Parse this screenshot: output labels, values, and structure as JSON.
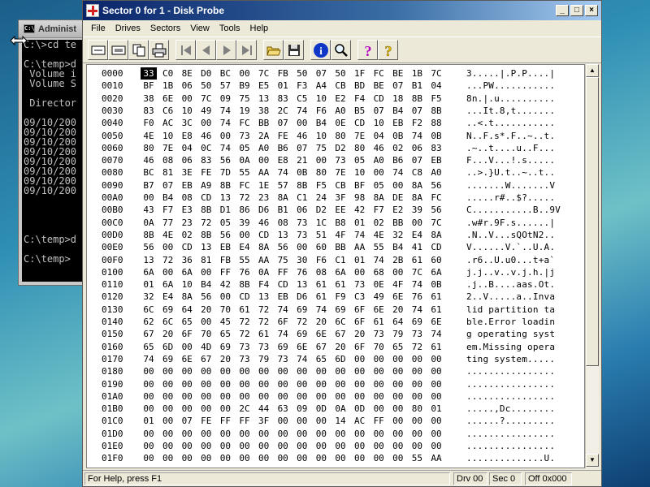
{
  "console": {
    "title": "Administ",
    "lines": [
      "C:\\>cd te",
      "",
      "C:\\temp>d",
      " Volume i",
      " Volume S",
      "",
      " Director",
      "",
      "09/10/200",
      "09/10/200",
      "09/10/200",
      "09/10/200",
      "09/10/200",
      "09/10/200",
      "09/10/200",
      "09/10/200",
      "",
      "",
      "",
      "",
      "C:\\temp>d",
      "",
      "C:\\temp>"
    ]
  },
  "window": {
    "title": "Sector 0 for 1 - Disk Probe"
  },
  "menu": [
    "File",
    "Drives",
    "Sectors",
    "View",
    "Tools",
    "Help"
  ],
  "toolbar": {
    "icons": [
      "read-sector-icon",
      "write-sector-icon",
      "copy-icon",
      "print-icon",
      "first-sector-icon",
      "previous-sector-icon",
      "next-sector-icon",
      "last-sector-icon",
      "open-file-icon",
      "save-icon",
      "info-icon",
      "find-icon",
      "help-icon",
      "context-help-icon"
    ]
  },
  "hex": {
    "selected_byte": "33",
    "rows": [
      {
        "offset": "0000",
        "bytes": [
          "33",
          "C0",
          "8E",
          "D0",
          "BC",
          "00",
          "7C",
          "FB",
          "50",
          "07",
          "50",
          "1F",
          "FC",
          "BE",
          "1B",
          "7C"
        ],
        "ascii": "3.....|.P.P....|"
      },
      {
        "offset": "0010",
        "bytes": [
          "BF",
          "1B",
          "06",
          "50",
          "57",
          "B9",
          "E5",
          "01",
          "F3",
          "A4",
          "CB",
          "BD",
          "BE",
          "07",
          "B1",
          "04"
        ],
        "ascii": "...PW..........."
      },
      {
        "offset": "0020",
        "bytes": [
          "38",
          "6E",
          "00",
          "7C",
          "09",
          "75",
          "13",
          "83",
          "C5",
          "10",
          "E2",
          "F4",
          "CD",
          "18",
          "8B",
          "F5"
        ],
        "ascii": "8n.|.u.........."
      },
      {
        "offset": "0030",
        "bytes": [
          "83",
          "C6",
          "10",
          "49",
          "74",
          "19",
          "38",
          "2C",
          "74",
          "F6",
          "A0",
          "B5",
          "07",
          "B4",
          "07",
          "8B"
        ],
        "ascii": "...It.8,t......."
      },
      {
        "offset": "0040",
        "bytes": [
          "F0",
          "AC",
          "3C",
          "00",
          "74",
          "FC",
          "BB",
          "07",
          "00",
          "B4",
          "0E",
          "CD",
          "10",
          "EB",
          "F2",
          "88"
        ],
        "ascii": "..<.t..........."
      },
      {
        "offset": "0050",
        "bytes": [
          "4E",
          "10",
          "E8",
          "46",
          "00",
          "73",
          "2A",
          "FE",
          "46",
          "10",
          "80",
          "7E",
          "04",
          "0B",
          "74",
          "0B"
        ],
        "ascii": "N..F.s*.F..~..t."
      },
      {
        "offset": "0060",
        "bytes": [
          "80",
          "7E",
          "04",
          "0C",
          "74",
          "05",
          "A0",
          "B6",
          "07",
          "75",
          "D2",
          "80",
          "46",
          "02",
          "06",
          "83"
        ],
        "ascii": ".~..t....u..F..."
      },
      {
        "offset": "0070",
        "bytes": [
          "46",
          "08",
          "06",
          "83",
          "56",
          "0A",
          "00",
          "E8",
          "21",
          "00",
          "73",
          "05",
          "A0",
          "B6",
          "07",
          "EB"
        ],
        "ascii": "F...V...!.s....."
      },
      {
        "offset": "0080",
        "bytes": [
          "BC",
          "81",
          "3E",
          "FE",
          "7D",
          "55",
          "AA",
          "74",
          "0B",
          "80",
          "7E",
          "10",
          "00",
          "74",
          "C8",
          "A0"
        ],
        "ascii": "..>.}U.t..~..t.."
      },
      {
        "offset": "0090",
        "bytes": [
          "B7",
          "07",
          "EB",
          "A9",
          "8B",
          "FC",
          "1E",
          "57",
          "8B",
          "F5",
          "CB",
          "BF",
          "05",
          "00",
          "8A",
          "56"
        ],
        "ascii": ".......W.......V"
      },
      {
        "offset": "00A0",
        "bytes": [
          "00",
          "B4",
          "08",
          "CD",
          "13",
          "72",
          "23",
          "8A",
          "C1",
          "24",
          "3F",
          "98",
          "8A",
          "DE",
          "8A",
          "FC"
        ],
        "ascii": ".....r#..$?....."
      },
      {
        "offset": "00B0",
        "bytes": [
          "43",
          "F7",
          "E3",
          "8B",
          "D1",
          "86",
          "D6",
          "B1",
          "06",
          "D2",
          "EE",
          "42",
          "F7",
          "E2",
          "39",
          "56"
        ],
        "ascii": "C...........B..9V"
      },
      {
        "offset": "00C0",
        "bytes": [
          "0A",
          "77",
          "23",
          "72",
          "05",
          "39",
          "46",
          "08",
          "73",
          "1C",
          "B8",
          "01",
          "02",
          "BB",
          "00",
          "7C"
        ],
        "ascii": ".w#r.9F.s......|"
      },
      {
        "offset": "00D0",
        "bytes": [
          "8B",
          "4E",
          "02",
          "8B",
          "56",
          "00",
          "CD",
          "13",
          "73",
          "51",
          "4F",
          "74",
          "4E",
          "32",
          "E4",
          "8A"
        ],
        "ascii": ".N..V...sQOtN2.."
      },
      {
        "offset": "00E0",
        "bytes": [
          "56",
          "00",
          "CD",
          "13",
          "EB",
          "E4",
          "8A",
          "56",
          "00",
          "60",
          "BB",
          "AA",
          "55",
          "B4",
          "41",
          "CD"
        ],
        "ascii": "V......V.`..U.A."
      },
      {
        "offset": "00F0",
        "bytes": [
          "13",
          "72",
          "36",
          "81",
          "FB",
          "55",
          "AA",
          "75",
          "30",
          "F6",
          "C1",
          "01",
          "74",
          "2B",
          "61",
          "60"
        ],
        "ascii": ".r6..U.u0...t+a`"
      },
      {
        "offset": "0100",
        "bytes": [
          "6A",
          "00",
          "6A",
          "00",
          "FF",
          "76",
          "0A",
          "FF",
          "76",
          "08",
          "6A",
          "00",
          "68",
          "00",
          "7C",
          "6A"
        ],
        "ascii": "j.j..v..v.j.h.|j"
      },
      {
        "offset": "0110",
        "bytes": [
          "01",
          "6A",
          "10",
          "B4",
          "42",
          "8B",
          "F4",
          "CD",
          "13",
          "61",
          "61",
          "73",
          "0E",
          "4F",
          "74",
          "0B"
        ],
        "ascii": ".j..B....aas.Ot."
      },
      {
        "offset": "0120",
        "bytes": [
          "32",
          "E4",
          "8A",
          "56",
          "00",
          "CD",
          "13",
          "EB",
          "D6",
          "61",
          "F9",
          "C3",
          "49",
          "6E",
          "76",
          "61"
        ],
        "ascii": "2..V.....a..Inva"
      },
      {
        "offset": "0130",
        "bytes": [
          "6C",
          "69",
          "64",
          "20",
          "70",
          "61",
          "72",
          "74",
          "69",
          "74",
          "69",
          "6F",
          "6E",
          "20",
          "74",
          "61"
        ],
        "ascii": "lid partition ta"
      },
      {
        "offset": "0140",
        "bytes": [
          "62",
          "6C",
          "65",
          "00",
          "45",
          "72",
          "72",
          "6F",
          "72",
          "20",
          "6C",
          "6F",
          "61",
          "64",
          "69",
          "6E"
        ],
        "ascii": "ble.Error loadin"
      },
      {
        "offset": "0150",
        "bytes": [
          "67",
          "20",
          "6F",
          "70",
          "65",
          "72",
          "61",
          "74",
          "69",
          "6E",
          "67",
          "20",
          "73",
          "79",
          "73",
          "74"
        ],
        "ascii": "g operating syst"
      },
      {
        "offset": "0160",
        "bytes": [
          "65",
          "6D",
          "00",
          "4D",
          "69",
          "73",
          "73",
          "69",
          "6E",
          "67",
          "20",
          "6F",
          "70",
          "65",
          "72",
          "61"
        ],
        "ascii": "em.Missing opera"
      },
      {
        "offset": "0170",
        "bytes": [
          "74",
          "69",
          "6E",
          "67",
          "20",
          "73",
          "79",
          "73",
          "74",
          "65",
          "6D",
          "00",
          "00",
          "00",
          "00",
          "00"
        ],
        "ascii": "ting system....."
      },
      {
        "offset": "0180",
        "bytes": [
          "00",
          "00",
          "00",
          "00",
          "00",
          "00",
          "00",
          "00",
          "00",
          "00",
          "00",
          "00",
          "00",
          "00",
          "00",
          "00"
        ],
        "ascii": "................"
      },
      {
        "offset": "0190",
        "bytes": [
          "00",
          "00",
          "00",
          "00",
          "00",
          "00",
          "00",
          "00",
          "00",
          "00",
          "00",
          "00",
          "00",
          "00",
          "00",
          "00"
        ],
        "ascii": "................"
      },
      {
        "offset": "01A0",
        "bytes": [
          "00",
          "00",
          "00",
          "00",
          "00",
          "00",
          "00",
          "00",
          "00",
          "00",
          "00",
          "00",
          "00",
          "00",
          "00",
          "00"
        ],
        "ascii": "................"
      },
      {
        "offset": "01B0",
        "bytes": [
          "00",
          "00",
          "00",
          "00",
          "00",
          "2C",
          "44",
          "63",
          "09",
          "0D",
          "0A",
          "0D",
          "00",
          "00",
          "80",
          "01"
        ],
        "ascii": ".....,Dc........"
      },
      {
        "offset": "01C0",
        "bytes": [
          "01",
          "00",
          "07",
          "FE",
          "FF",
          "FF",
          "3F",
          "00",
          "00",
          "00",
          "14",
          "AC",
          "FF",
          "00",
          "00",
          "00"
        ],
        "ascii": "......?........."
      },
      {
        "offset": "01D0",
        "bytes": [
          "00",
          "00",
          "00",
          "00",
          "00",
          "00",
          "00",
          "00",
          "00",
          "00",
          "00",
          "00",
          "00",
          "00",
          "00",
          "00"
        ],
        "ascii": "................"
      },
      {
        "offset": "01E0",
        "bytes": [
          "00",
          "00",
          "00",
          "00",
          "00",
          "00",
          "00",
          "00",
          "00",
          "00",
          "00",
          "00",
          "00",
          "00",
          "00",
          "00"
        ],
        "ascii": "................"
      },
      {
        "offset": "01F0",
        "bytes": [
          "00",
          "00",
          "00",
          "00",
          "00",
          "00",
          "00",
          "00",
          "00",
          "00",
          "00",
          "00",
          "00",
          "00",
          "55",
          "AA"
        ],
        "ascii": "..............U."
      }
    ]
  },
  "status": {
    "help": "For Help, press F1",
    "drive": "Drv  00",
    "sector": "Sec 0",
    "offset": "Off 0x000"
  },
  "colors": {
    "title_active": "#0a246a",
    "window_bg": "#ece9d8",
    "selection": "#000000"
  }
}
